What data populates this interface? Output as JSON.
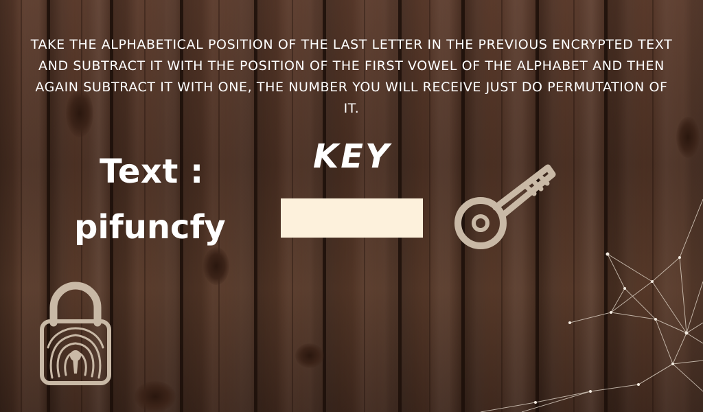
{
  "puzzle": {
    "instructions": "TAKE THE ALPHABETICAL POSITION OF THE LAST LETTER IN THE PREVIOUS ENCRYPTED TEXT AND SUBTRACT IT WITH THE POSITION OF THE FIRST VOWEL OF THE ALPHABET AND THEN AGAIN SUBTRACT IT WITH ONE,  THE NUMBER YOU WILL RECEIVE JUST DO PERMUTATION OF IT.",
    "text_label": "Text :",
    "cipher_text": "pifuncfy",
    "key_heading": "KEY",
    "key_input_value": ""
  },
  "icons": {
    "key": "key-icon",
    "padlock": "padlock-fingerprint-icon",
    "decor": "constellation-network"
  },
  "colors": {
    "wood_dark": "#3f281d",
    "wood_mid": "#563828",
    "text": "#ffffff",
    "input_bg": "#fdf1dc",
    "icon_tint": "#c9b9a6"
  }
}
